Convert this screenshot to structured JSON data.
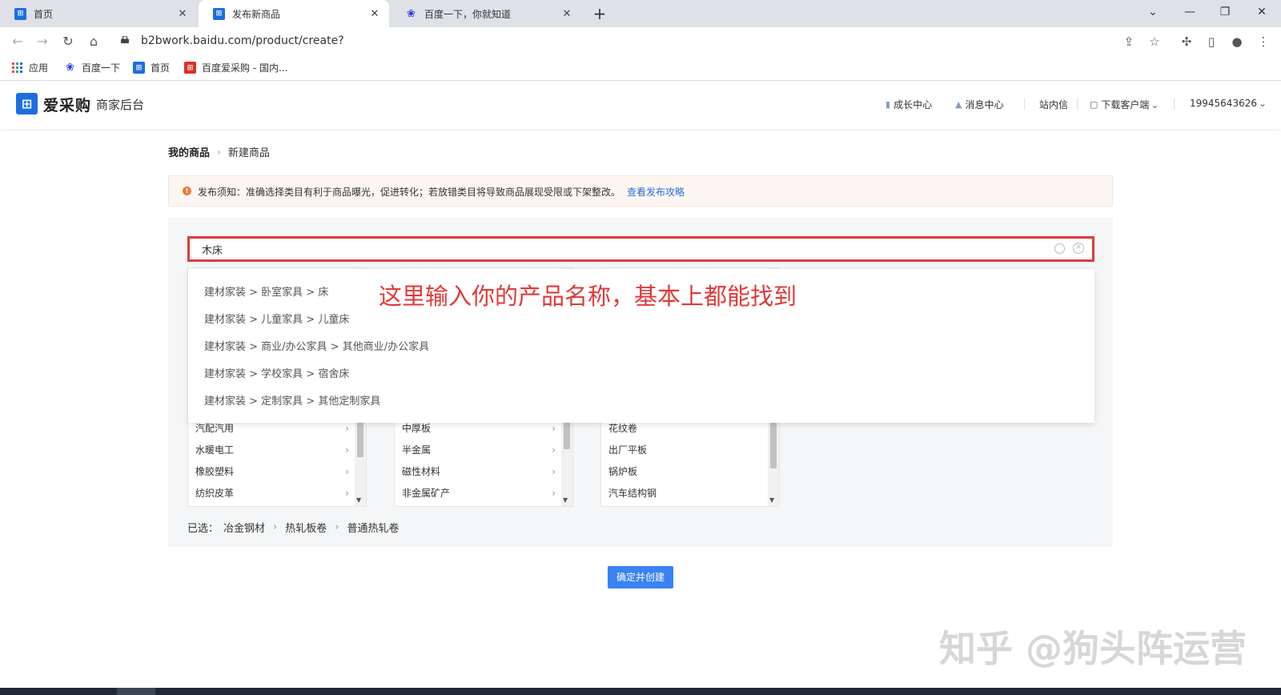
{
  "browser": {
    "tabs": [
      {
        "title": "首页",
        "favicon": "aicaigou-icon"
      },
      {
        "title": "发布新商品",
        "favicon": "aicaigou-icon"
      },
      {
        "title": "百度一下，你就知道",
        "favicon": "baidu-paw-icon"
      }
    ],
    "active_tab": 1,
    "url": "b2bwork.baidu.com/product/create?",
    "bookmarks": [
      "应用",
      "百度一下",
      "首页",
      "百度爱采购 - 国内..."
    ]
  },
  "header": {
    "logo": "爱采购",
    "subtitle": "商家后台",
    "nav": [
      "成长中心",
      "消息中心",
      "站内信",
      "下载客户端"
    ],
    "user": "19945643626"
  },
  "breadcrumb": {
    "parent": "我的商品",
    "current": "新建商品"
  },
  "notice": {
    "text": "发布须知：准确选择类目有利于商品曝光，促进转化；若放错类目将导致商品展现受限或下架整改。",
    "link": "查看发布攻略"
  },
  "search": {
    "value": "木床"
  },
  "suggestions": [
    "建材家装 > 卧室家具 > 床",
    "建材家装 > 儿童家具 > 儿童床",
    "建材家装 > 商业/办公家具 > 其他商业/办公家具",
    "建材家装 > 学校家具 > 宿舍床",
    "建材家装 > 定制家具 > 其他定制家具"
  ],
  "annotation": "这里输入你的产品名称，基本上都能找到",
  "columns": [
    {
      "items": [
        "汽配汽用",
        "水暖电工",
        "橡胶塑料",
        "纺织皮革"
      ]
    },
    {
      "items": [
        "中厚板",
        "半金属",
        "磁性材料",
        "非金属矿产"
      ]
    },
    {
      "items": [
        "花纹卷",
        "出厂平板",
        "锅炉板",
        "汽车结构钢"
      ]
    }
  ],
  "selected": {
    "label": "已选：",
    "path": [
      "冶金钢材",
      "热轧板卷",
      "普通热轧卷"
    ]
  },
  "confirm_button": "确定并创建",
  "watermark": "知乎 @狗头阵运营",
  "colors": {
    "accent": "#3a82f2",
    "highlight": "#e03a3a",
    "brand": "#1d6ee0"
  }
}
